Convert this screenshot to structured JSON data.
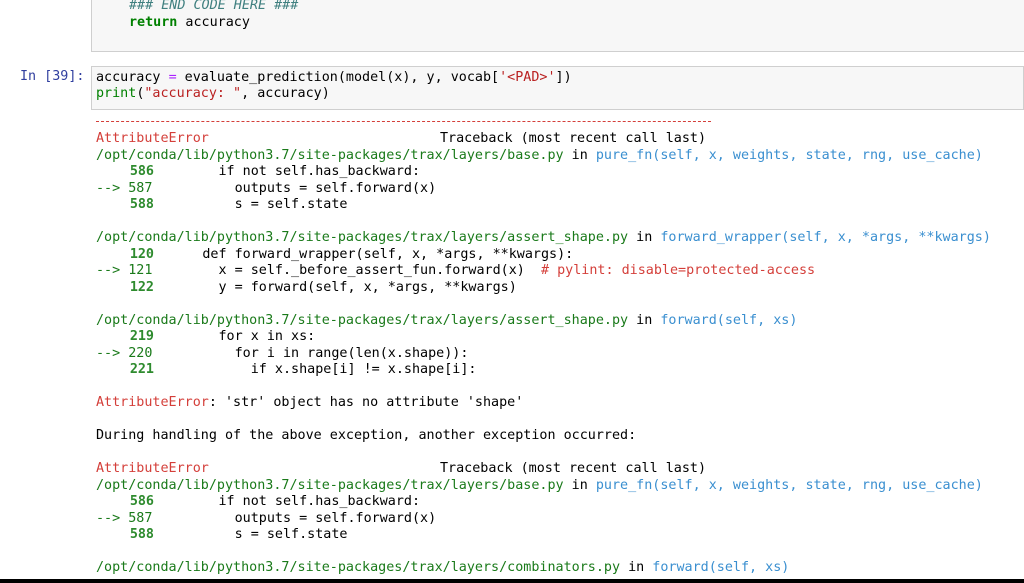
{
  "prev_cell": {
    "comment": "### END CODE HERE ###",
    "return_kw": "return",
    "return_val": " accuracy"
  },
  "cell": {
    "prompt": "In [39]:",
    "line1_a": "accuracy ",
    "line1_eq": "=",
    "line1_b": " evaluate_prediction(model(x), y, vocab[",
    "line1_str": "'<PAD>'",
    "line1_c": "])",
    "line2_fn": "print",
    "line2_a": "(",
    "line2_str": "\"accuracy: \"",
    "line2_b": ", accuracy)"
  },
  "traceback": {
    "err_name": "AttributeError",
    "tb_header": "Traceback (most recent call last)",
    "frames": [
      {
        "path": "/opt/conda/lib/python3.7/site-packages/trax/layers/base.py",
        "in_kw": " in ",
        "func": "pure_fn(self, x, weights, state, rng, use_cache)",
        "l1n": "586",
        "l1": "        if not self.has_backward:",
        "l2n": "--> 587",
        "l2": "          outputs = self.forward(x)",
        "l3n": "588",
        "l3": "          s = self.state"
      },
      {
        "path": "/opt/conda/lib/python3.7/site-packages/trax/layers/assert_shape.py",
        "in_kw": " in ",
        "func": "forward_wrapper(self, x, *args, **kwargs)",
        "l1n": "120",
        "l1": "      def forward_wrapper(self, x, *args, **kwargs):",
        "l2n": "--> 121",
        "l2": "        x = self._before_assert_fun.forward(x)",
        "l2c": "  # pylint: disable=protected-access",
        "l3n": "122",
        "l3": "        y = forward(self, x, *args, **kwargs)"
      },
      {
        "path": "/opt/conda/lib/python3.7/site-packages/trax/layers/assert_shape.py",
        "in_kw": " in ",
        "func": "forward(self, xs)",
        "l1n": "219",
        "l1": "        for x in xs:",
        "l2n": "--> 220",
        "l2": "          for i in range(len(x.shape)):",
        "l3n": "221",
        "l3": "            if x.shape[i] != x.shape[i]:"
      }
    ],
    "error_msg_name": "AttributeError",
    "error_msg": ": 'str' object has no attribute 'shape'",
    "during": "During handling of the above exception, another exception occurred:",
    "err_name2": "AttributeError",
    "tb_header2": "Traceback (most recent call last)",
    "frame4": {
      "path": "/opt/conda/lib/python3.7/site-packages/trax/layers/base.py",
      "in_kw": " in ",
      "func": "pure_fn(self, x, weights, state, rng, use_cache)",
      "l1n": "586",
      "l1": "        if not self.has_backward:",
      "l2n": "--> 587",
      "l2": "          outputs = self.forward(x)",
      "l3n": "588",
      "l3": "          s = self.state"
    },
    "frame5": {
      "path": "/opt/conda/lib/python3.7/site-packages/trax/layers/combinators.py",
      "in_kw": " in ",
      "func": "forward(self, xs)"
    }
  }
}
